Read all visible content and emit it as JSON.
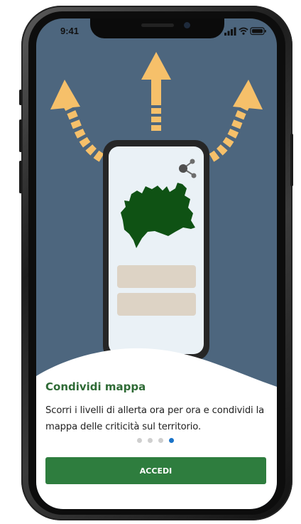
{
  "status_bar": {
    "time": "9:41"
  },
  "onboarding": {
    "title": "Condividi mappa",
    "description": "Scorri i livelli di allerta ora per ora e condividi la mappa delle criticità sul territorio.",
    "page_indicator": {
      "total": 4,
      "active_index": 3
    },
    "primary_button_label": "ACCEDI"
  },
  "colors": {
    "background": "#4d667e",
    "arrow": "#f6c06a",
    "map_region": "#0f5214",
    "button": "#2e7d3e",
    "title": "#2f6b36",
    "active_dot": "#1a73c8"
  },
  "icons": [
    "share-icon",
    "signal-icon",
    "wifi-icon",
    "battery-icon"
  ]
}
